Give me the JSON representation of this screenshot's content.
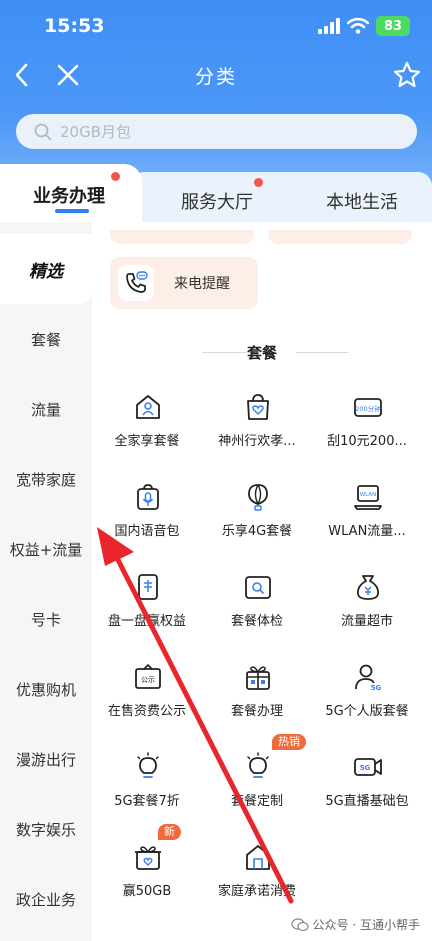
{
  "status_bar": {
    "time": "15:53",
    "battery": "83"
  },
  "nav": {
    "title": "分类"
  },
  "search": {
    "placeholder": "20GB月包"
  },
  "tabs": [
    {
      "label": "业务办理",
      "active": true,
      "dot": true
    },
    {
      "label": "服务大厅",
      "active": false,
      "dot": true
    },
    {
      "label": "本地生活",
      "active": false,
      "dot": false
    }
  ],
  "sidebar": {
    "items": [
      {
        "label": "精选",
        "active": true
      },
      {
        "label": "套餐"
      },
      {
        "label": "流量"
      },
      {
        "label": "宽带家庭"
      },
      {
        "label": "权益+流量"
      },
      {
        "label": "号卡"
      },
      {
        "label": "优惠购机"
      },
      {
        "label": "漫游出行"
      },
      {
        "label": "数字娱乐"
      },
      {
        "label": "政企业务"
      }
    ]
  },
  "main": {
    "featured": {
      "label": "来电提醒",
      "icon": "phone-call-icon"
    },
    "section_title": "套餐",
    "grid": [
      {
        "label": "全家享套餐",
        "icon": "home-person-icon"
      },
      {
        "label": "神州行欢孝...",
        "icon": "bag-heart-icon"
      },
      {
        "label": "刮10元200...",
        "icon": "scratch-card-icon",
        "icon_text": "200分钟"
      },
      {
        "label": "国内语音包",
        "icon": "microphone-bag-icon"
      },
      {
        "label": "乐享4G套餐",
        "icon": "balloon-icon"
      },
      {
        "label": "WLAN流量...",
        "icon": "wlan-laptop-icon",
        "icon_text": "WLAN"
      },
      {
        "label": "盘一盘赢权益",
        "icon": "coupon-card-icon"
      },
      {
        "label": "套餐体检",
        "icon": "checkup-search-icon"
      },
      {
        "label": "流量超市",
        "icon": "money-bag-icon"
      },
      {
        "label": "在售资费公示",
        "icon": "notice-board-icon",
        "icon_text": "公示"
      },
      {
        "label": "套餐办理",
        "icon": "gift-box-icon"
      },
      {
        "label": "5G个人版套餐",
        "icon": "person-5g-icon",
        "icon_text": "5G"
      },
      {
        "label": "5G套餐7折",
        "icon": "lightbulb-icon"
      },
      {
        "label": "套餐定制",
        "icon": "lightbulb-icon",
        "badge": "热销"
      },
      {
        "label": "5G直播基础包",
        "icon": "video-camera-icon",
        "icon_text": "5G"
      },
      {
        "label": "赢50GB",
        "icon": "gift-heart-icon",
        "badge": "新"
      },
      {
        "label": "家庭承诺消费",
        "icon": "house-icon"
      }
    ]
  },
  "watermark": {
    "text": "公众号 · 互通小帮手"
  },
  "colors": {
    "header_blue": "#3f8ef5",
    "active_tab_underline": "#2f7ff1",
    "badge": "#f06b3c",
    "annotation_arrow": "#e8262b"
  }
}
